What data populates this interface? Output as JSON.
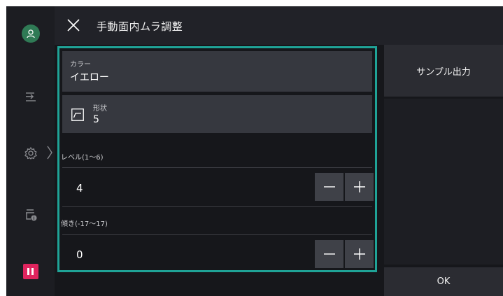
{
  "header": {
    "title": "手動面内ムラ調整"
  },
  "color": {
    "label": "カラー",
    "value": "イエロー"
  },
  "shape": {
    "label": "形状",
    "value": "5"
  },
  "level": {
    "label": "レベル(1〜6)",
    "value": "4"
  },
  "tilt": {
    "label": "傾き(-17〜17)",
    "value": "0"
  },
  "actions": {
    "sample": "サンプル出力",
    "ok": "OK"
  },
  "colors": {
    "accent": "#1fa397",
    "pause": "#e0245e",
    "avatar": "#2f7a55"
  }
}
